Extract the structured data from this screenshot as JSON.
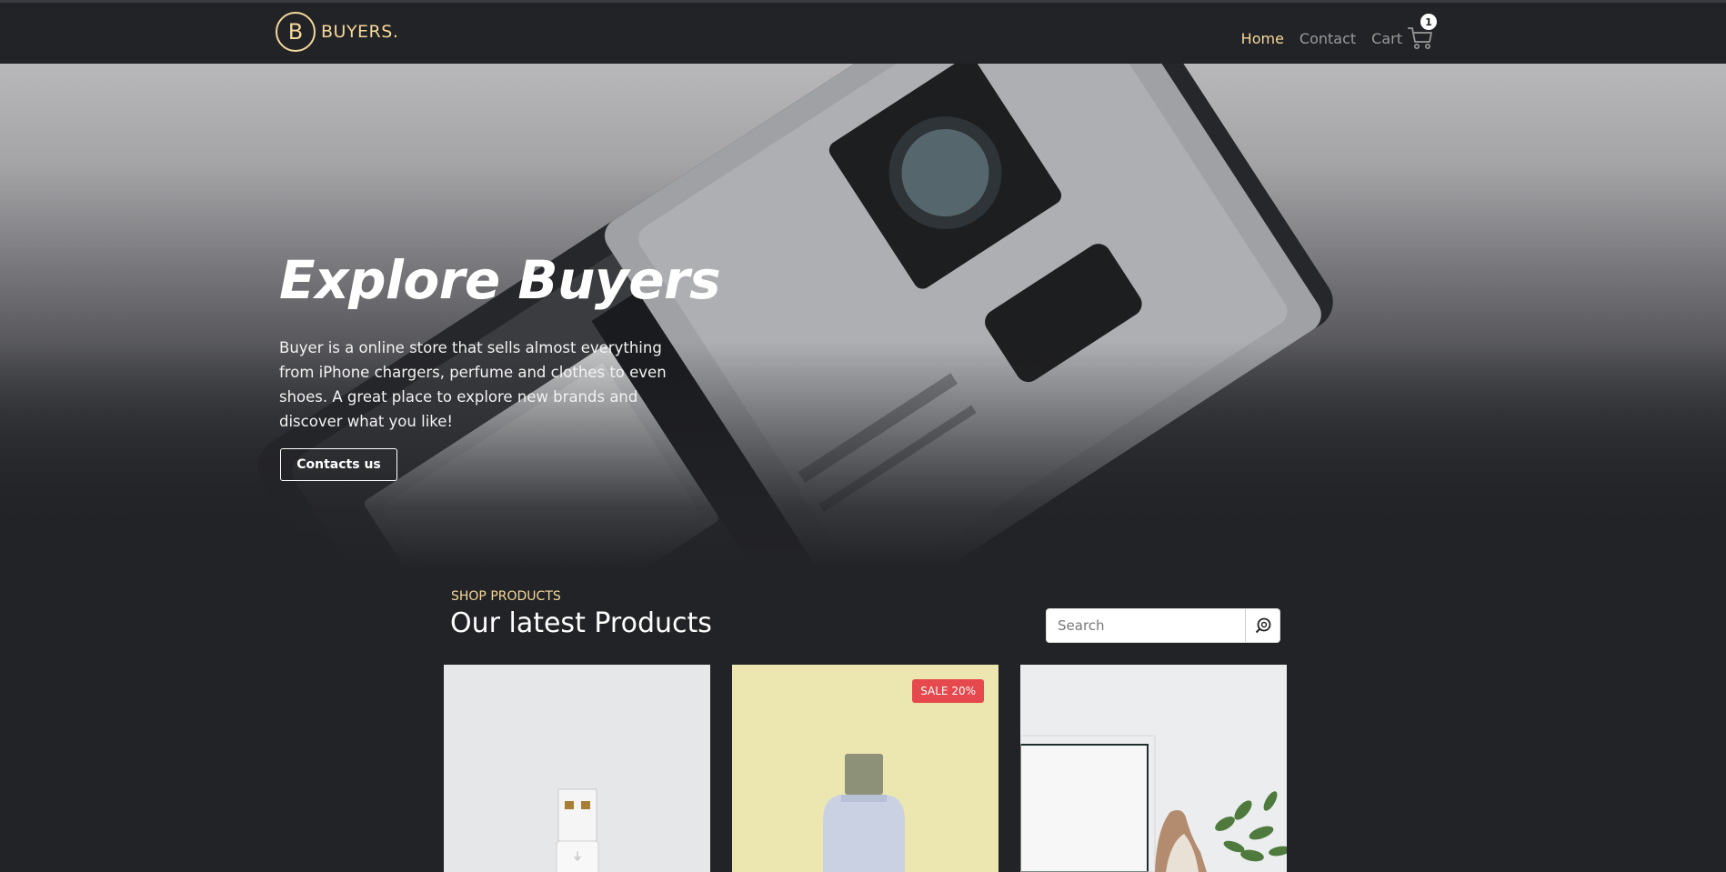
{
  "brand": {
    "initial": "B",
    "name": "BUYERS."
  },
  "nav": {
    "home": "Home",
    "contact": "Contact",
    "cart": "Cart",
    "cart_count": "1"
  },
  "hero": {
    "title": "Explore Buyers",
    "text": "Buyer is a online store that sells almost everything from iPhone chargers, perfume and clothes to even shoes. A great place to explore new brands and discover what you like!",
    "button": "Contacts us"
  },
  "products": {
    "eyebrow": "SHOP PRODUCTS",
    "title": "Our latest Products",
    "search_placeholder": "Search",
    "items": [
      {
        "image": "usb-charger"
      },
      {
        "image": "perfume-bottle",
        "badge": "SALE 20%"
      },
      {
        "image": "shoes"
      }
    ]
  },
  "colors": {
    "accent": "#f5d89a",
    "background": "#222327",
    "sale": "#e5484d"
  }
}
